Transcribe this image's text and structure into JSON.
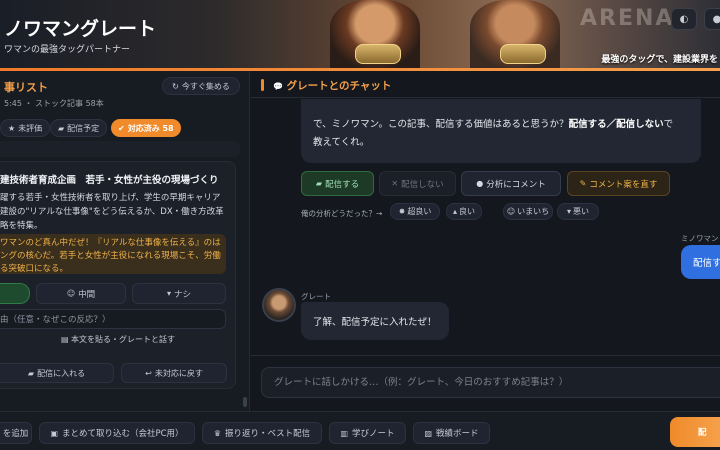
{
  "header": {
    "title": "ノワマングレート",
    "subtitle": "ワマンの最強タッグパートナー",
    "tagline": "最強のタッグで、建設業界を",
    "arena_text": "ARENA"
  },
  "left_panel": {
    "title": "事リスト",
    "meta": "5:45 ・ ストック記事 58本",
    "collect_button": "今すぐ集める",
    "filters": [
      {
        "label": "未評価",
        "active": false
      },
      {
        "label": "配信予定",
        "active": false
      },
      {
        "label": "対応済み 58",
        "active": true
      }
    ],
    "card": {
      "title": "建技術者育成企画　若手・女性が主役の現場づくり",
      "body": "躍する若手・女性技術者を取り上げ、学生の早期キャリア建設の\"リアルな仕事像\"をどう伝えるか、DX・働き方改革略を特集。",
      "note": "ワマンのど真ん中だぜ！『リアルな仕事像を伝える』のはングの核心だ。若手と女性が主役になれる現場こそ、労働る突破口になる。",
      "rating_mid": "中間",
      "rating_no": "ナシ",
      "reason_placeholder": "由（任意・なぜこの反応？）",
      "paste_button": "本文を貼る・グレートと話す",
      "schedule_button": "配信に入れる",
      "revert_button": "未対応に戻す"
    }
  },
  "chat": {
    "title": "グレートとのチャット",
    "message1_line1": "で、ミノワマン。この記事、配信する価値はあると思うか？",
    "message1_bold": "配信する／配信しない",
    "message1_line1_end": "で",
    "message1_line2": "教えてくれ。",
    "actions": {
      "publish": "配信する",
      "no_publish": "配信しない",
      "analysis": "分析にコメント",
      "fix_comment": "コメント案を直す"
    },
    "feedback_label": "俺の分析どうだった？→",
    "feedback": [
      "超良い",
      "良い",
      "いまいち",
      "悪い"
    ],
    "user_name": "ミノワマン",
    "user_message": "配信す",
    "bot_name": "グレート",
    "bot_message": "了解、配信予定に入れたぜ！",
    "input_placeholder": "グレートに話しかける…（例：グレート、今日のおすすめ記事は？）"
  },
  "toolbar": {
    "add": "を追加",
    "bulk_import": "まとめて取り込む（会社PC用）",
    "review": "振り返り・ベスト配信",
    "notes": "学びノート",
    "record": "戦績ボード",
    "primary": "配"
  },
  "colors": {
    "accent": "#f08a2a",
    "user_bubble": "#2f6fe0",
    "panel_bg": "#171b22"
  }
}
